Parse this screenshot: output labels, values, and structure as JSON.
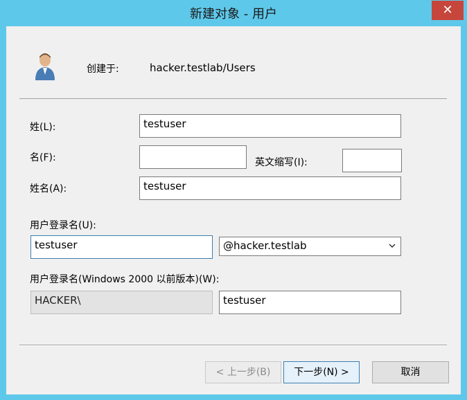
{
  "window": {
    "title": "新建对象 - 用户",
    "close_glyph": "✕"
  },
  "header": {
    "icon": "user-icon",
    "created_in_label": "创建于:",
    "created_in_value": "hacker.testlab/Users"
  },
  "form": {
    "last_name_label": "姓(L):",
    "last_name_value": "testuser",
    "first_name_label": "名(F):",
    "first_name_value": "",
    "initials_label": "英文缩写(I):",
    "initials_value": "",
    "full_name_label": "姓名(A):",
    "full_name_value": "testuser",
    "logon_name_label": "用户登录名(U):",
    "logon_name_value": "testuser",
    "domain_suffix_value": "@hacker.testlab",
    "legacy_logon_label": "用户登录名(Windows 2000 以前版本)(W):",
    "legacy_domain_value": "HACKER\\",
    "legacy_logon_value": "testuser"
  },
  "buttons": {
    "back_label": "< 上一步(B)",
    "next_label": "下一步(N) >",
    "cancel_label": "取消"
  },
  "colors": {
    "titlebar": "#5ec8ea",
    "close": "#c7463c",
    "dialog_bg": "#f0f0f0"
  }
}
